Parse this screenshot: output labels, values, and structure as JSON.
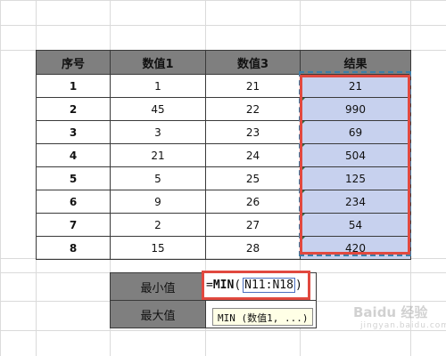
{
  "table": {
    "headers": [
      "序号",
      "数值1",
      "数值3",
      "结果"
    ],
    "rows": [
      {
        "idx": "1",
        "v1": "1",
        "v3": "21",
        "res": "21"
      },
      {
        "idx": "2",
        "v1": "45",
        "v3": "22",
        "res": "990"
      },
      {
        "idx": "3",
        "v1": "3",
        "v3": "23",
        "res": "69"
      },
      {
        "idx": "4",
        "v1": "21",
        "v3": "24",
        "res": "504"
      },
      {
        "idx": "5",
        "v1": "5",
        "v3": "25",
        "res": "125"
      },
      {
        "idx": "6",
        "v1": "9",
        "v3": "26",
        "res": "234"
      },
      {
        "idx": "7",
        "v1": "2",
        "v3": "27",
        "res": "54"
      },
      {
        "idx": "8",
        "v1": "15",
        "v3": "28",
        "res": "420"
      }
    ]
  },
  "summary": {
    "min_label": "最小值",
    "max_label": "最大值",
    "formula_prefix": "=",
    "formula_fn": "MIN",
    "formula_open": "(",
    "formula_ref": "N11:N18",
    "formula_close": ")",
    "tooltip": "MIN (数值1, ...)"
  },
  "watermark": {
    "brand": "Baidu 经验",
    "sub": "jingyan.baidu.com"
  },
  "colors": {
    "header_bg": "#7f7f7f",
    "result_bg": "#c7d1ee",
    "highlight_red": "#e1493f"
  }
}
